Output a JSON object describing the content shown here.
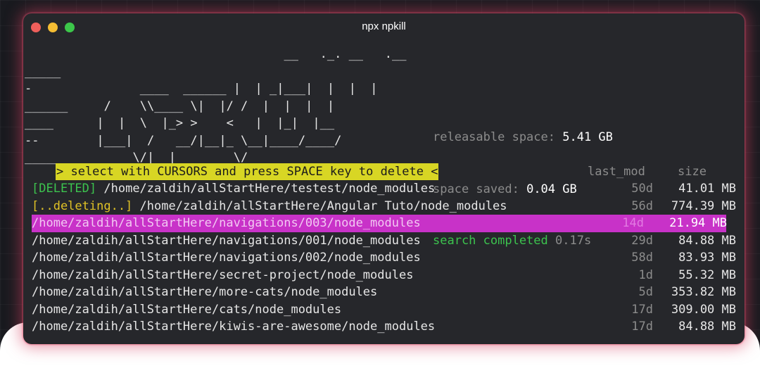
{
  "window": {
    "title": "npx npkill",
    "traffic_colors": [
      "#ee5f5b",
      "#f4bd33",
      "#3cc74a"
    ]
  },
  "logo": {
    "text": "_____\n-               ____  ______ |  | _|___|  |  |  |\n______     /    \\\\____ \\|  |/ /  |  |  |  |\n____      |  |  \\  |_> >    <   |  |_|  |__\n--        |___|  /   __/|__|_ \\__|____/____/\n_______        \\/|__|        \\/",
    "top_line": "                                    __   ._. __   .__"
  },
  "stats": {
    "releasable_label": "releasable space:",
    "releasable_value": "5.41 GB",
    "saved_label": "space saved:",
    "saved_value": "0.04 GB",
    "search_status": "search completed",
    "search_time": "0.17s"
  },
  "header": {
    "instruction": "> select with CURSORS and press SPACE key to delete <",
    "last_mod": "last_mod",
    "size": "size"
  },
  "colors": {
    "terminal_bg": "#26272b",
    "selection": "#c832c8",
    "instruction_bg": "#d8d624",
    "deleted_green": "#3cc34e",
    "deleting_yellow": "#e0c226"
  },
  "rows": [
    {
      "tag": "[DELETED]",
      "path": "/home/zaldih/allStartHere/testest/node_modules",
      "days": "50d",
      "size": "41.01 MB"
    },
    {
      "tag": "[..deleting..]",
      "path": "/home/zaldih/allStartHere/Angular Tuto/node_modules",
      "days": "56d",
      "size": "774.39 MB"
    },
    {
      "tag": "",
      "path": "/home/zaldih/allStartHere/navigations/003/node_modules",
      "days": "14d",
      "size": "21.94 MB"
    },
    {
      "tag": "",
      "path": "/home/zaldih/allStartHere/navigations/001/node_modules",
      "days": "29d",
      "size": "84.88 MB"
    },
    {
      "tag": "",
      "path": "/home/zaldih/allStartHere/navigations/002/node_modules",
      "days": "58d",
      "size": "83.93 MB"
    },
    {
      "tag": "",
      "path": "/home/zaldih/allStartHere/secret-project/node_modules",
      "days": "1d",
      "size": "55.32 MB"
    },
    {
      "tag": "",
      "path": "/home/zaldih/allStartHere/more-cats/node_modules",
      "days": "5d",
      "size": "353.82 MB"
    },
    {
      "tag": "",
      "path": "/home/zaldih/allStartHere/cats/node_modules",
      "days": "17d",
      "size": "309.00 MB"
    },
    {
      "tag": "",
      "path": "/home/zaldih/allStartHere/kiwis-are-awesome/node_modules",
      "days": "17d",
      "size": "84.88 MB"
    }
  ]
}
